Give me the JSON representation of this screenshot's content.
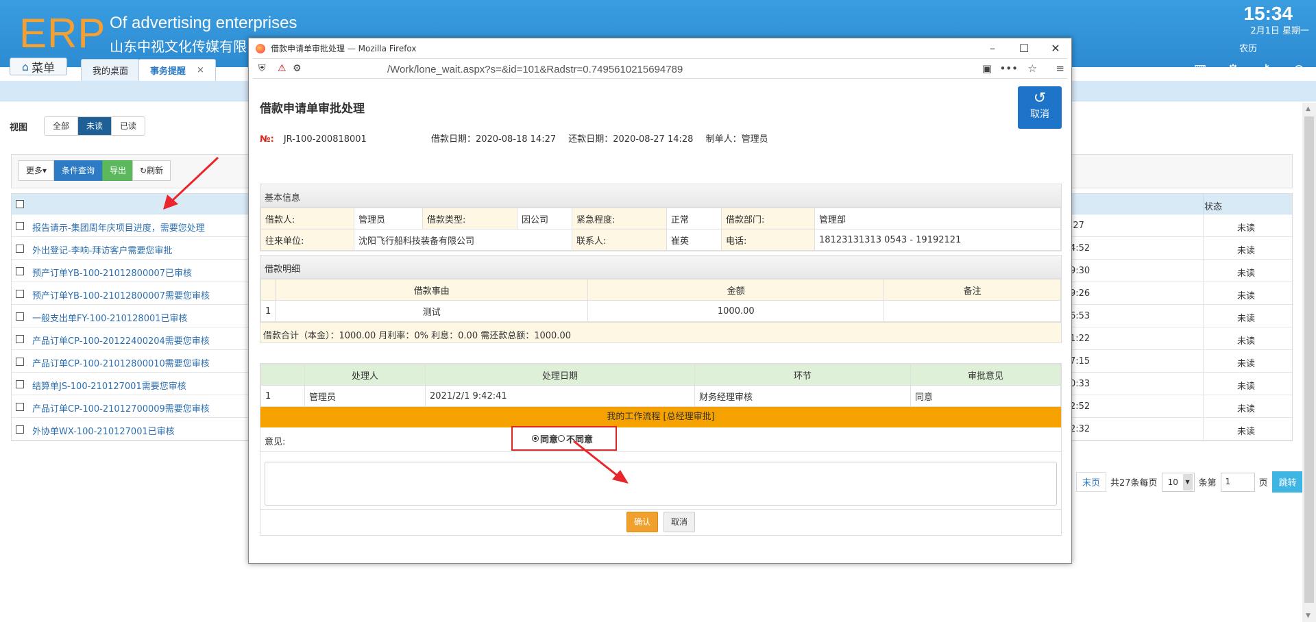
{
  "header": {
    "logo": "ERP",
    "company_en": "Of advertising enterprises",
    "company_cn": "山东中视文化传媒有限",
    "time": "15:34",
    "date": "2月1日 星期一",
    "lunar": "农历",
    "menu_label": "菜单",
    "tabs": [
      {
        "label": "我的桌面"
      },
      {
        "label": "事务提醒",
        "close": "×"
      }
    ]
  },
  "page": {
    "view_label": "视图",
    "view_filters": [
      "全部",
      "未读",
      "已读"
    ],
    "toolbar": {
      "more": "更多▾",
      "query": "条件查询",
      "export": "导出",
      "refresh": "刷新"
    },
    "list_header": {
      "status": "状态"
    },
    "rows": [
      {
        "title": "报告请示-集团周年庆项目进度，需要您处理",
        "time": ":27",
        "status": "未读"
      },
      {
        "title": "外出登记-李响-拜访客户需要您审批",
        "time": "4:52",
        "status": "未读"
      },
      {
        "title": "预产订单YB-100-21012800007已审核",
        "time": "9:30",
        "status": "未读"
      },
      {
        "title": "预产订单YB-100-21012800007需要您审核",
        "time": "9:26",
        "status": "未读"
      },
      {
        "title": "一般支出单FY-100-210128001已审核",
        "time": "6:53",
        "status": "未读"
      },
      {
        "title": "产品订单CP-100-20122400204需要您审核",
        "time": "1:22",
        "status": "未读"
      },
      {
        "title": "产品订单CP-100-21012800010需要您审核",
        "time": "7:15",
        "status": "未读"
      },
      {
        "title": "结算单JS-100-210127001需要您审核",
        "time": "0:33",
        "status": "未读"
      },
      {
        "title": "产品订单CP-100-21012700009需要您审核",
        "time": "2:52",
        "status": "未读"
      },
      {
        "title": "外协单WX-100-210127001已审核",
        "time": "2:32",
        "status": "未读"
      }
    ],
    "pager": {
      "last": "末页",
      "total_text": "共27条每页",
      "page_size": "10",
      "per_text": "条第",
      "page_input": "1",
      "page_unit": "页",
      "go": "跳转"
    }
  },
  "popup": {
    "window_title": "借款申请单审批处理 — Mozilla Firefox",
    "url": "/Work/lone_wait.aspx?s=&id=101&Radstr=0.7495610215694789",
    "heading": "借款申请单审批处理",
    "cancel_label": "取消",
    "no_label": "№:",
    "no_value": "JR-100-200818001",
    "borrow_date": "借款日期：2020-08-18 14:27",
    "return_date": "还款日期：2020-08-27 14:28",
    "maker": "制单人：管理员",
    "basic": {
      "title": "基本信息",
      "borrower_label": "借款人:",
      "borrower": "管理员",
      "type_label": "借款类型:",
      "type": "因公司",
      "urgency_label": "紧急程度:",
      "urgency": "正常",
      "dept_label": "借款部门:",
      "dept": "管理部",
      "unit_label": "往来单位:",
      "unit": "沈阳飞行船科技装备有限公司",
      "contact_label": "联系人:",
      "contact": "崔英",
      "phone_label": "电话:",
      "phone": "18123131313 0543 - 19192121"
    },
    "detail": {
      "title": "借款明细",
      "headers": [
        "借款事由",
        "金额",
        "备注"
      ],
      "rows": [
        {
          "idx": "1",
          "reason": "测试",
          "amount": "1000.00",
          "note": ""
        }
      ],
      "summary": "借款合计（本金）：1000.00   月利率：0%   利息：0.00   需还款总额：1000.00"
    },
    "history": {
      "headers": [
        "处理人",
        "处理日期",
        "环节",
        "审批意见"
      ],
      "rows": [
        {
          "idx": "1",
          "person": "管理员",
          "date": "2021/2/1 9:42:41",
          "step": "财务经理审核",
          "opinion": "同意"
        }
      ]
    },
    "workflow_bar": "我的工作流程 [总经理审批]",
    "opinion_label": "意见:",
    "agree": "同意",
    "disagree": "不同意",
    "confirm": "确认",
    "cancel": "取消"
  }
}
